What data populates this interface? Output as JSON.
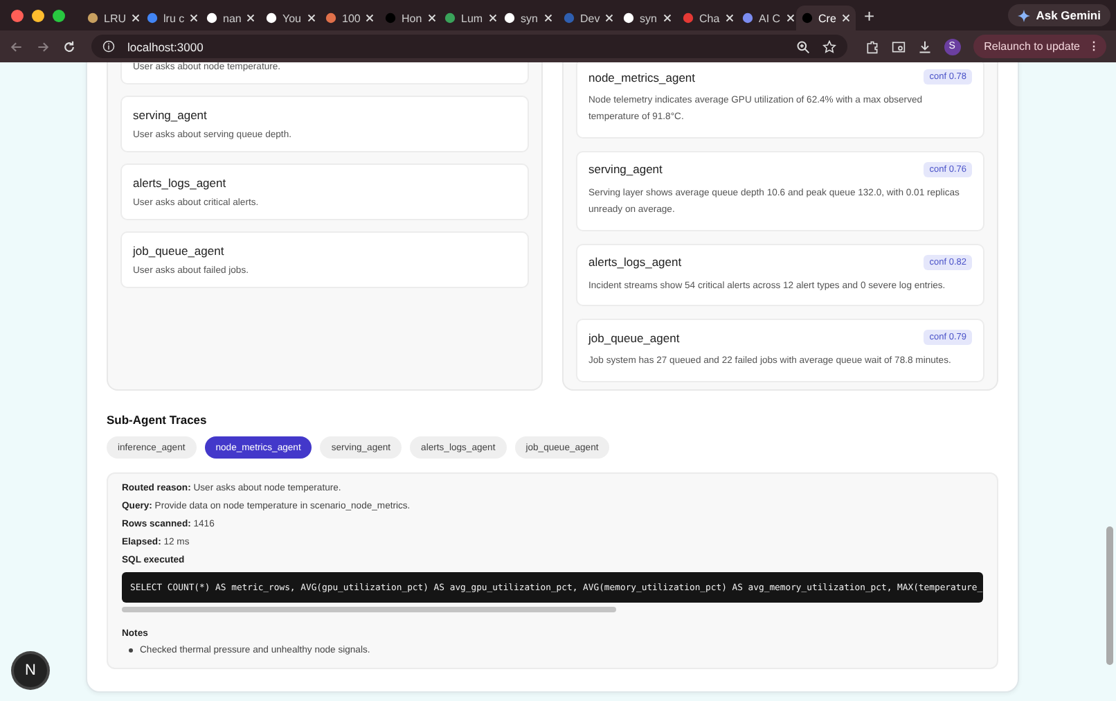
{
  "browser": {
    "tabs": [
      {
        "title": "LRU",
        "color": "#c8a060",
        "selected": false
      },
      {
        "title": "lru c",
        "color": "#4285f4",
        "selected": false
      },
      {
        "title": "nan",
        "color": "#ffffff",
        "selected": false
      },
      {
        "title": "You",
        "color": "#ffffff",
        "selected": false
      },
      {
        "title": "100",
        "color": "#e0704a",
        "selected": false
      },
      {
        "title": "Hon",
        "color": "#000000",
        "selected": false
      },
      {
        "title": "Lum",
        "color": "#3aa35a",
        "selected": false
      },
      {
        "title": "syn",
        "color": "#ffffff",
        "selected": false
      },
      {
        "title": "Dev",
        "color": "#2f5fb0",
        "selected": false
      },
      {
        "title": "syn",
        "color": "#ffffff",
        "selected": false
      },
      {
        "title": "Cha",
        "color": "#e53935",
        "selected": false
      },
      {
        "title": "AI C",
        "color": "#7b8cf0",
        "selected": false
      },
      {
        "title": "Cre",
        "color": "#000000",
        "selected": true
      }
    ],
    "new_tab": "+",
    "gemini": "Ask Gemini",
    "url": "localhost:3000",
    "profile": "S",
    "relaunch": "Relaunch to update",
    "menu": "⋮"
  },
  "routes": [
    {
      "reason": "User asks about node temperature."
    },
    {
      "agent": "serving_agent",
      "reason": "User asks about serving queue depth."
    },
    {
      "agent": "alerts_logs_agent",
      "reason": "User asks about critical alerts."
    },
    {
      "agent": "job_queue_agent",
      "reason": "User asks about failed jobs."
    }
  ],
  "findings": [
    {
      "agent": "node_metrics_agent",
      "conf": "conf 0.78",
      "text": "Node telemetry indicates average GPU utilization of 62.4% with a max observed temperature of 91.8°C."
    },
    {
      "agent": "serving_agent",
      "conf": "conf 0.76",
      "text": "Serving layer shows average queue depth 10.6 and peak queue 132.0, with 0.01 replicas unready on average."
    },
    {
      "agent": "alerts_logs_agent",
      "conf": "conf 0.82",
      "text": "Incident streams show 54 critical alerts across 12 alert types and 0 severe log entries."
    },
    {
      "agent": "job_queue_agent",
      "conf": "conf 0.79",
      "text": "Job system has 27 queued and 22 failed jobs with average queue wait of 78.8 minutes."
    }
  ],
  "traces": {
    "title": "Sub-Agent Traces",
    "tabs": [
      {
        "label": "inference_agent",
        "selected": false
      },
      {
        "label": "node_metrics_agent",
        "selected": true
      },
      {
        "label": "serving_agent",
        "selected": false
      },
      {
        "label": "alerts_logs_agent",
        "selected": false
      },
      {
        "label": "job_queue_agent",
        "selected": false
      }
    ],
    "fields": [
      {
        "label": "Routed reason:",
        "value": "User asks about node temperature."
      },
      {
        "label": "Query:",
        "value": "Provide data on node temperature in scenario_node_metrics."
      },
      {
        "label": "Rows scanned:",
        "value": "1416"
      },
      {
        "label": "Elapsed:",
        "value": "12 ms"
      }
    ],
    "sql_title": "SQL executed",
    "sql": "SELECT COUNT(*) AS metric_rows, AVG(gpu_utilization_pct) AS avg_gpu_utilization_pct, AVG(memory_utilization_pct) AS avg_memory_utilization_pct, MAX(temperature_",
    "notes_title": "Notes",
    "notes": [
      "Checked thermal pressure and unhealthy node signals."
    ]
  },
  "dev_badge": "N"
}
